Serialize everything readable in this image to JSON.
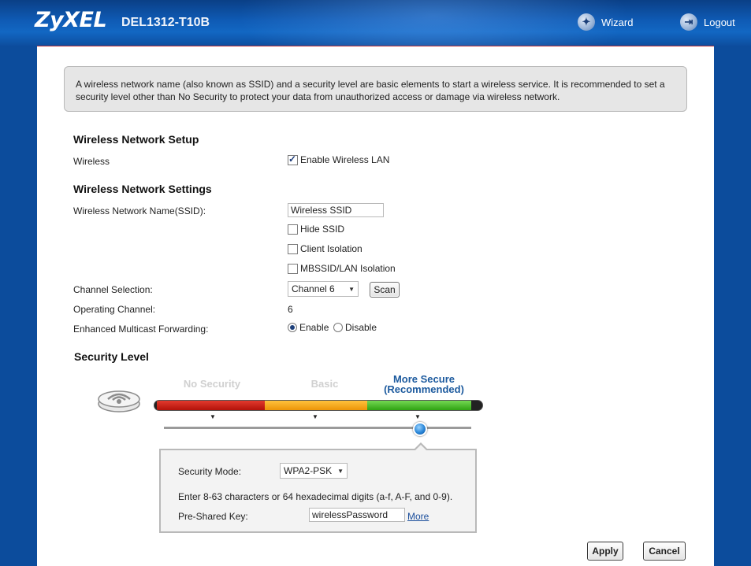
{
  "header": {
    "brand": "ZyXEL",
    "model": "DEL1312-T10B",
    "wizard_label": "Wizard",
    "logout_label": "Logout"
  },
  "info_text": "A wireless network name (also known as SSID) and a security level are basic elements to start a wireless service. It is recommended to set a security level other than No Security to protect your data from unauthorized access or damage via wireless network.",
  "setup": {
    "title": "Wireless Network Setup",
    "wireless_label": "Wireless",
    "enable_wlan_label": "Enable Wireless LAN",
    "enable_wlan_checked": true
  },
  "settings": {
    "title": "Wireless Network Settings",
    "ssid_label": "Wireless Network Name(SSID):",
    "ssid_value": "Wireless SSID",
    "hide_ssid_label": "Hide SSID",
    "client_isolation_label": "Client Isolation",
    "mbssid_label": "MBSSID/LAN Isolation",
    "channel_label": "Channel Selection:",
    "channel_value": "Channel 6",
    "scan_label": "Scan",
    "operating_channel_label": "Operating Channel:",
    "operating_channel_value": "6",
    "multicast_label": "Enhanced Multicast Forwarding:",
    "enable_label": "Enable",
    "disable_label": "Disable"
  },
  "security": {
    "title": "Security Level",
    "levels": [
      "No Security",
      "Basic",
      "More Secure",
      "(Recommended)"
    ],
    "selected_level": "More Secure",
    "level_colors": {
      "none": "#c2160f",
      "basic": "#f5a20d",
      "secure": "#3fb81f"
    },
    "mode_label": "Security Mode:",
    "mode_value": "WPA2-PSK",
    "hint": "Enter 8-63 characters or 64 hexadecimal digits (a-f, A-F, and 0-9).",
    "psk_label": "Pre-Shared Key:",
    "psk_value": "wirelessPassword",
    "more_label": "More"
  },
  "actions": {
    "apply_label": "Apply",
    "cancel_label": "Cancel"
  }
}
